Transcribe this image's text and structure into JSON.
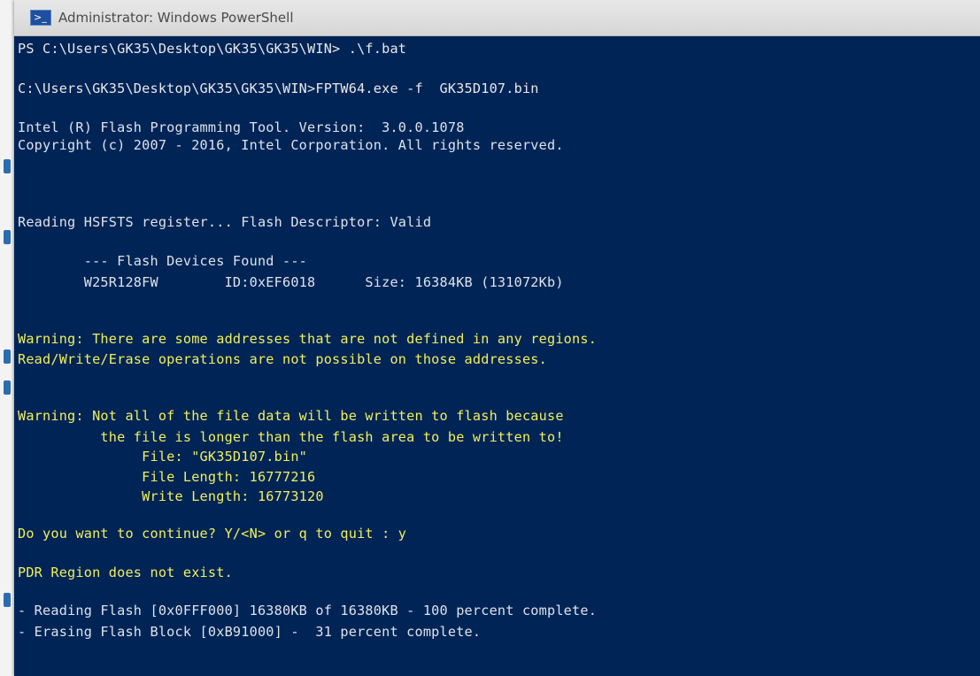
{
  "window": {
    "title": "Administrator: Windows PowerShell",
    "icon": "powershell-icon",
    "background_color": "#012456"
  },
  "console": {
    "lines": [
      "PS C:\\Users\\GK35\\Desktop\\GK35\\GK35\\WIN> .\\f.bat",
      "C:\\Users\\GK35\\Desktop\\GK35\\GK35\\WIN>FPTW64.exe -f  GK35D107.bin",
      "Intel (R) Flash Programming Tool. Version:  3.0.0.1078",
      "Copyright (c) 2007 - 2016, Intel Corporation. All rights reserved.",
      "Reading HSFSTS register... Flash Descriptor: Valid",
      "        --- Flash Devices Found ---",
      "        W25R128FW        ID:0xEF6018      Size: 16384KB (131072Kb)",
      "Warning: There are some addresses that are not defined in any regions.",
      "Read/Write/Erase operations are not possible on those addresses.",
      "Warning: Not all of the file data will be written to flash because",
      "          the file is longer than the flash area to be written to!",
      "               File: \"GK35D107.bin\"",
      "               File Length: 16777216",
      "               Write Length: 16773120",
      "Do you want to continue? Y/<N> or q to quit : y",
      "PDR Region does not exist.",
      "- Reading Flash [0x0FFF000] 16380KB of 16380KB - 100 percent complete.",
      "- Erasing Flash Block [0xB91000] -  31 percent complete."
    ]
  },
  "colors": {
    "text_white": "#dde3ea",
    "text_yellow": "#f0f05a"
  }
}
